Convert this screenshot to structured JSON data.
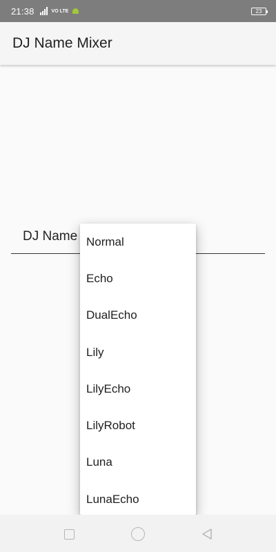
{
  "status_bar": {
    "time": "21:38",
    "network": "VO LTE",
    "battery": "23",
    "icons": [
      "signal-icon",
      "android-icon",
      "battery-icon"
    ]
  },
  "app_bar": {
    "title": "DJ Name Mixer"
  },
  "form": {
    "dj_name_label": "DJ Name"
  },
  "dropdown": {
    "items": [
      {
        "label": "Normal"
      },
      {
        "label": "Echo"
      },
      {
        "label": "DualEcho"
      },
      {
        "label": "Lily"
      },
      {
        "label": "LilyEcho"
      },
      {
        "label": "LilyRobot"
      },
      {
        "label": "Luna"
      },
      {
        "label": "LunaEcho"
      }
    ]
  },
  "nav_bar": {
    "icons": [
      "recents-icon",
      "home-icon",
      "back-icon"
    ]
  },
  "colors": {
    "status_bar": "#7d7d7d",
    "app_bar": "#f5f5f5",
    "background": "#fafafa",
    "popup": "#ffffff",
    "nav_icon": "#b5b5b5"
  }
}
